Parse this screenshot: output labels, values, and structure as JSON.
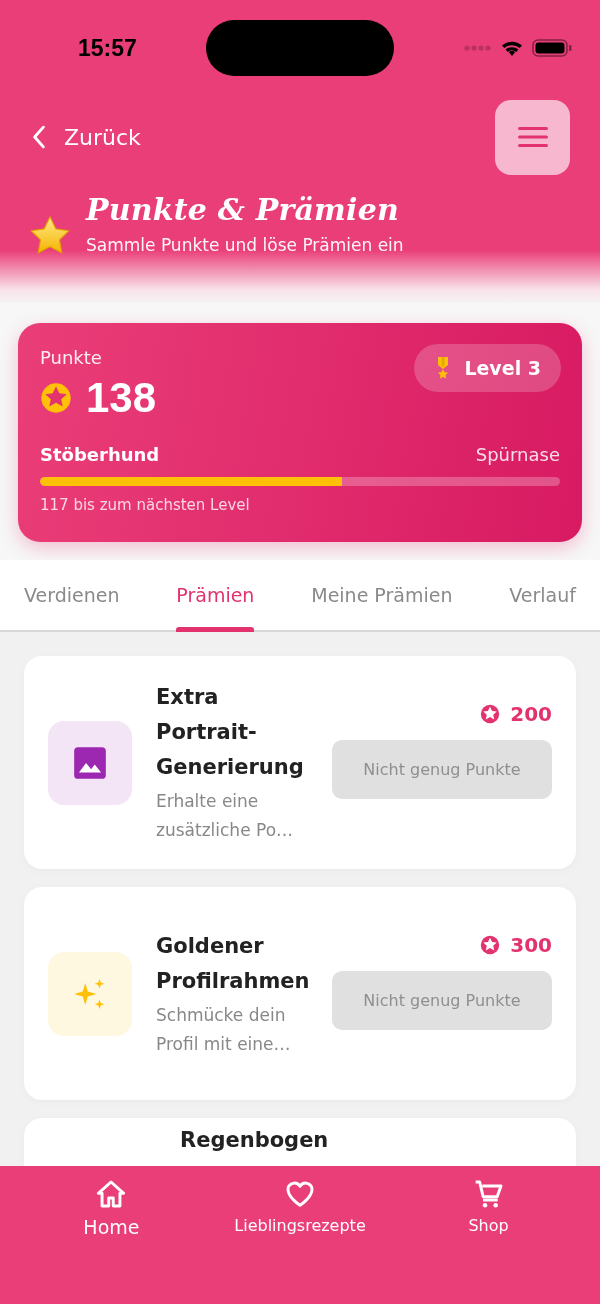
{
  "status_bar": {
    "time": "15:57"
  },
  "header": {
    "back_label": "Zurück",
    "title": "Punkte & Prämien",
    "subtitle": "Sammle Punkte und löse Prämien ein"
  },
  "points_card": {
    "label": "Punkte",
    "points": "138",
    "level_badge": "Level 3",
    "current_rank": "Stöberhund",
    "next_rank": "Spürnase",
    "level": 0.58,
    "progress_text": "117 bis zum nächsten Level"
  },
  "tabs": [
    {
      "label": "Verdienen",
      "selected": false
    },
    {
      "label": "Prämien",
      "selected": true
    },
    {
      "label": "Meine Prämien",
      "selected": false
    },
    {
      "label": "Verlauf",
      "selected": false
    }
  ],
  "rewards": [
    {
      "kind": "image",
      "title": "Extra Portrait-Generierung",
      "description": "Erhalte eine zusätzliche Po…",
      "cost": "200",
      "button": "Nicht genug Punkte",
      "disabled": true
    },
    {
      "kind": "sparkle",
      "title": "Goldener Profilrahmen",
      "description": "Schmücke dein Profil mit eine…",
      "cost": "300",
      "button": "Nicht genug Punkte",
      "disabled": true
    },
    {
      "kind": "partial",
      "title": "Regenbogen"
    }
  ],
  "bottom_nav": [
    {
      "kind": "home",
      "label": "Home",
      "selected": true
    },
    {
      "kind": "heart",
      "label": "Lieblingsrezepte",
      "selected": false
    },
    {
      "kind": "cart",
      "label": "Shop",
      "selected": false
    }
  ]
}
